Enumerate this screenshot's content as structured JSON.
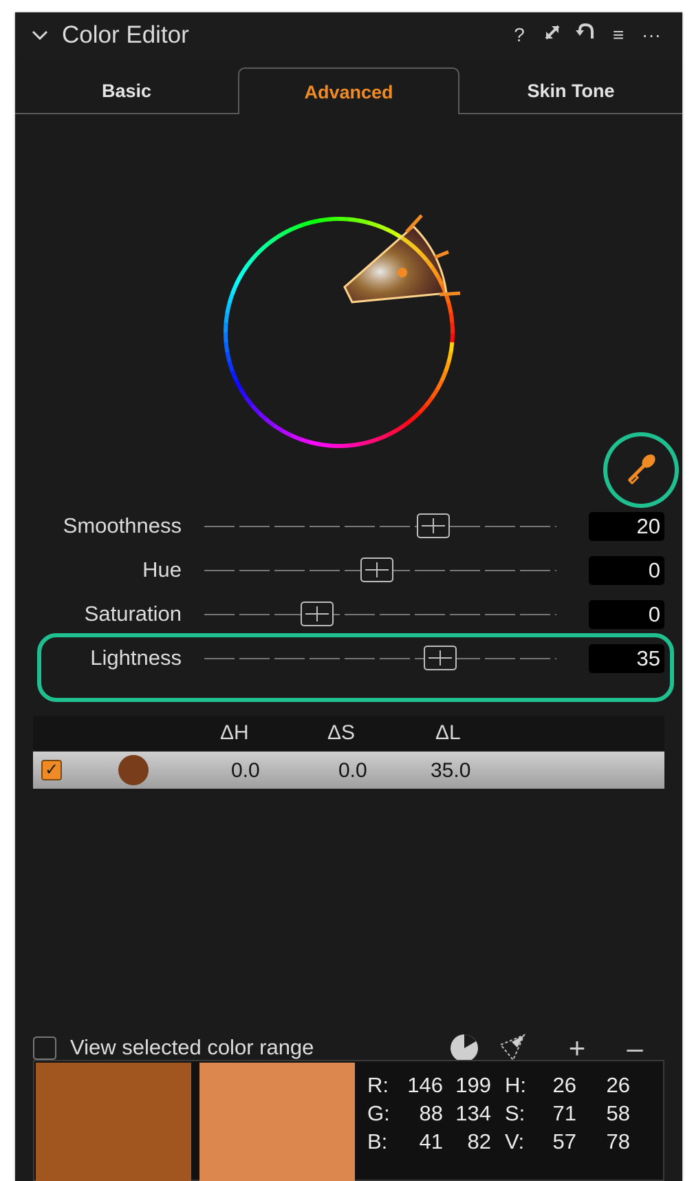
{
  "header": {
    "title": "Color Editor",
    "icons": [
      "chevron-down-icon",
      "help-icon",
      "expand-icon",
      "reset-icon",
      "list-icon",
      "more-icon"
    ],
    "icon_glyphs": {
      "help": "?",
      "expand": "⤢",
      "reset": "↶",
      "list": "≡",
      "more": "···"
    }
  },
  "tabs": [
    {
      "label": "Basic",
      "active": false
    },
    {
      "label": "Advanced",
      "active": true
    },
    {
      "label": "Skin Tone",
      "active": false
    }
  ],
  "colors": {
    "accent": "#f08a24",
    "highlight": "#1fbf8f",
    "panel": "#1b1b1b"
  },
  "sliders": [
    {
      "label": "Smoothness",
      "value": "20",
      "position": 0.65
    },
    {
      "label": "Hue",
      "value": "0",
      "position": 0.49
    },
    {
      "label": "Saturation",
      "value": "0",
      "position": 0.32
    },
    {
      "label": "Lightness",
      "value": "35",
      "position": 0.67
    }
  ],
  "color_table": {
    "headers": [
      "ΔH",
      "ΔS",
      "ΔL"
    ],
    "rows": [
      {
        "checked": true,
        "swatch": "#7a3d1c",
        "dh": "0.0",
        "ds": "0.0",
        "dl": "35.0"
      }
    ]
  },
  "view_range": {
    "label": "View selected color range",
    "checked": false,
    "icons": [
      "color-range-pie-icon",
      "color-range-pick-icon",
      "add-icon",
      "remove-icon"
    ],
    "glyphs": {
      "add": "+",
      "remove": "–"
    }
  },
  "swatches": {
    "original": "#a1561f",
    "adjusted": "#dc874e"
  },
  "readout": {
    "rows": [
      {
        "c1": "R:",
        "v1": "146",
        "v2": "199",
        "c2": "H:",
        "v3": "26",
        "v4": "26"
      },
      {
        "c1": "G:",
        "v1": "88",
        "v2": "134",
        "c2": "S:",
        "v3": "71",
        "v4": "58"
      },
      {
        "c1": "B:",
        "v1": "41",
        "v2": "82",
        "c2": "V:",
        "v3": "57",
        "v4": "78"
      }
    ]
  }
}
